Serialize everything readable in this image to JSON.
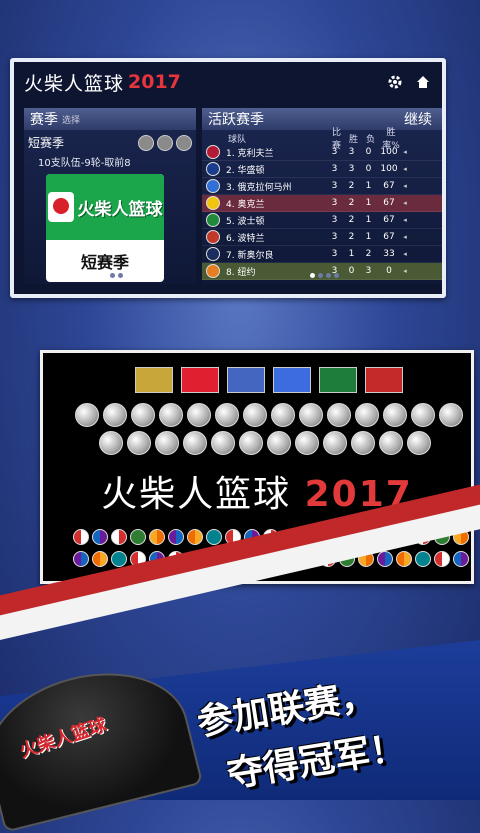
{
  "header": {
    "title": "火柴人篮球",
    "year": "2017"
  },
  "left_panel": {
    "tab_label": "赛季",
    "tab_sub": "选择",
    "league_name": "短赛季",
    "league_desc": "10支队伍-9轮-取前8",
    "logo_text": "火柴人篮球",
    "mode_label": "短赛季"
  },
  "right_panel": {
    "tab_label": "活跃赛季",
    "continue_label": "继续",
    "columns": {
      "team": "球队",
      "played": "比赛",
      "won": "胜",
      "lost": "负",
      "pct": "胜率%"
    },
    "rows": [
      {
        "rank_name": "1. 克利夫兰",
        "played": "3",
        "won": "3",
        "lost": "0",
        "pct": "100",
        "color": "#b31b34"
      },
      {
        "rank_name": "2. 华盛顿",
        "played": "3",
        "won": "3",
        "lost": "0",
        "pct": "100",
        "color": "#1a3c8c"
      },
      {
        "rank_name": "3. 俄克拉何马州",
        "played": "3",
        "won": "2",
        "lost": "1",
        "pct": "67",
        "color": "#2f6fd6"
      },
      {
        "rank_name": "4. 奥克兰",
        "played": "3",
        "won": "2",
        "lost": "1",
        "pct": "67",
        "color": "#f1c40f"
      },
      {
        "rank_name": "5. 波士顿",
        "played": "3",
        "won": "2",
        "lost": "1",
        "pct": "67",
        "color": "#1f8b3a"
      },
      {
        "rank_name": "6. 波特兰",
        "played": "3",
        "won": "2",
        "lost": "1",
        "pct": "67",
        "color": "#c0392b"
      },
      {
        "rank_name": "7. 新奥尔良",
        "played": "3",
        "won": "1",
        "lost": "2",
        "pct": "33",
        "color": "#1b2d5e"
      },
      {
        "rank_name": "8. 纽约",
        "played": "3",
        "won": "0",
        "lost": "3",
        "pct": "0",
        "color": "#e67e22"
      }
    ]
  },
  "showcase": {
    "title": "火柴人篮球",
    "year": "2017"
  },
  "slogan": {
    "line1": "参加联赛，",
    "line2": "夺得冠军！"
  },
  "cap_text": "火柴人篮球"
}
